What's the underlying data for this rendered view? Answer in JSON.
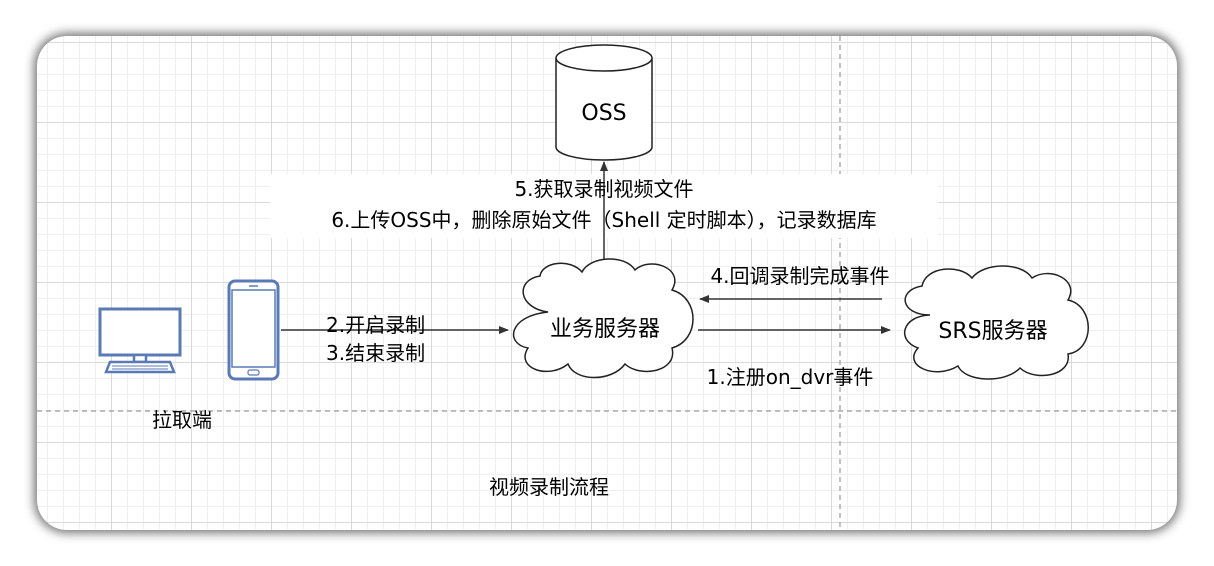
{
  "nodes": {
    "oss": "OSS",
    "business_server": "业务服务器",
    "srs_server": "SRS服务器",
    "pull_client": "拉取端"
  },
  "edges": {
    "step5": "5.获取录制视频文件",
    "step6": "6.上传OSS中，删除原始文件（Shell 定时脚本），记录数据库",
    "step2": "2.开启录制",
    "step3": "3.结束录制",
    "step4": "4.回调录制完成事件",
    "step1": "1.注册on_dvr事件"
  },
  "diagram_title": "视频录制流程",
  "colors": {
    "device_stroke": "#5a7ab5",
    "device_fill": "#ffffff",
    "line": "#333333"
  }
}
